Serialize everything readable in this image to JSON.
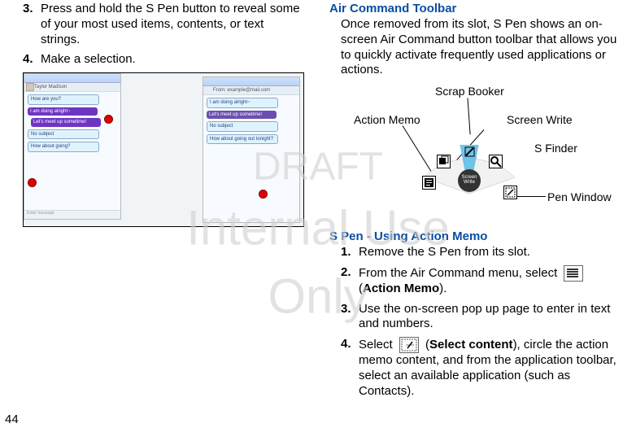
{
  "page_number": "44",
  "watermark_line1": "DRAFT",
  "watermark_line2": "Internal Use Only",
  "left": {
    "step3_num": "3.",
    "step3_text": "Press and hold the S Pen button to reveal some of your most used items, contents, or text strings.",
    "step4_num": "4.",
    "step4_text": "Make a selection.",
    "shot_bubbles_a": [
      "How are you?",
      "I am doing alright~",
      "Let's meet up sometime!",
      "No subject",
      "How about going?"
    ],
    "shot_footer_a": "Enter message",
    "shot_header_b": "From:  example@mail.com",
    "shot_bubbles_b": [
      "I am doing alright~",
      "Let's meet up sometime!",
      "No subject",
      "How about going out tonight?"
    ],
    "shot_header_name": "Taylor Madison"
  },
  "right": {
    "heading1": "Air Command Toolbar",
    "para1": "Once removed from its slot, S Pen shows an on-screen Air Command button toolbar that allows you to quickly activate frequently used applications or actions.",
    "diagram_labels": {
      "scrap": "Scrap Booker",
      "action": "Action Memo",
      "screen": "Screen Write",
      "sfinder": "S Finder",
      "pen": "Pen Window"
    },
    "hub_label": "Screen Write",
    "heading2": "S Pen - Using Action Memo",
    "step1_num": "1.",
    "step1_text": "Remove the S Pen from its slot.",
    "step2_num": "2.",
    "step2_pre": "From the Air Command menu, select ",
    "step2_post_open": " (",
    "step2_bold": "Action Memo",
    "step2_post_close": ").",
    "step3_num": "3.",
    "step3_text": "Use the on-screen pop up page to enter in text and numbers.",
    "step4_num": "4.",
    "step4_pre": "Select ",
    "step4_post_open": " (",
    "step4_bold": "Select content",
    "step4_post_close": "), circle the action memo content, and from the application toolbar, select an available application (such as Contacts)."
  }
}
